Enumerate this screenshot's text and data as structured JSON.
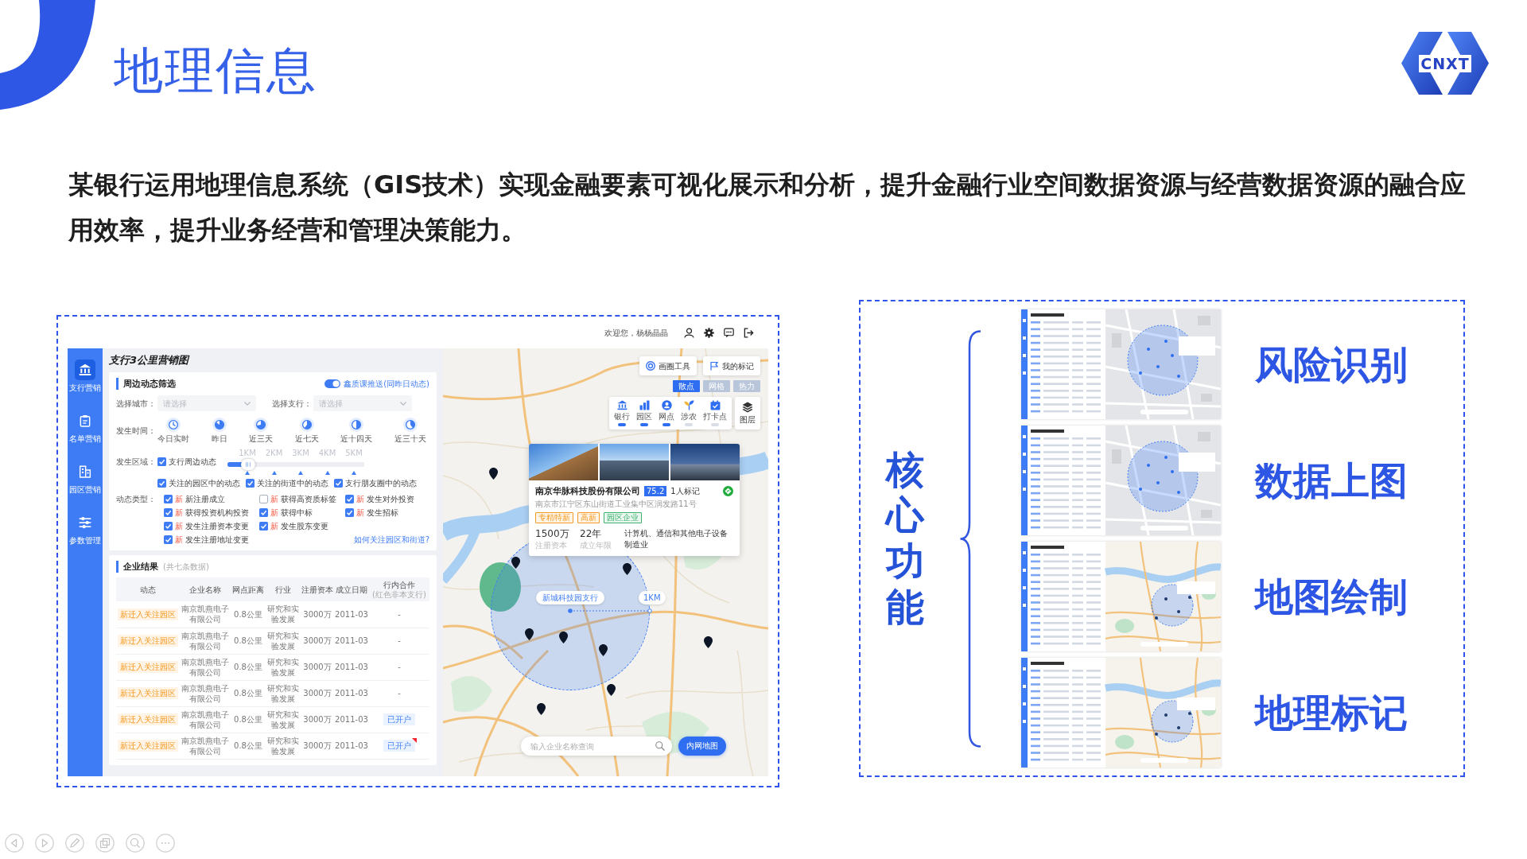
{
  "slide": {
    "title": "地理信息",
    "logo": "CNXT",
    "description": "某银行运用地理信息系统（GIS技术）实现金融要素可视化展示和分析，提升金融行业空间数据资源与经营数据资源的融合应用效率，提升业务经营和管理决策能力。"
  },
  "app": {
    "welcome": "欢迎您，杨杨晶晶",
    "sidebar": [
      {
        "label": "支行营销",
        "selected": true
      },
      {
        "label": "名单营销",
        "selected": false
      },
      {
        "label": "园区营销",
        "selected": false
      },
      {
        "label": "参数管理",
        "selected": false
      }
    ],
    "page_title": "支行3公里营销图",
    "filter": {
      "title": "周边动态筛选",
      "push": {
        "label": "鑫质课推送(同昨日动态)",
        "on": true
      },
      "selects": [
        {
          "label": "选择城市：",
          "placeholder": "请选择"
        },
        {
          "label": "选择支行：",
          "placeholder": "请选择"
        }
      ],
      "time_label": "发生时间：",
      "time_options": [
        "今日实时",
        "昨日",
        "近三天",
        "近七天",
        "近十四天",
        "近三十天"
      ],
      "region_label": "发生区域：",
      "nearby": {
        "label": "支行周边动态",
        "checked": true
      },
      "distance": {
        "marks": [
          "1KM",
          "2KM",
          "3KM",
          "4KM",
          "5KM"
        ],
        "level": 0.15
      },
      "scopes": [
        {
          "label": "关注的园区中的动态",
          "checked": true
        },
        {
          "label": "关注的街道中的动态",
          "checked": true
        },
        {
          "label": "支行朋友圈中的动态",
          "checked": true
        }
      ],
      "type_label": "动态类型：",
      "types": [
        {
          "tag": "新",
          "label": "新注册成立",
          "checked": true
        },
        {
          "tag": "新",
          "label": "获得高资质标签",
          "checked": false
        },
        {
          "tag": "新",
          "label": "发生对外投资",
          "checked": true
        },
        {
          "tag": "新",
          "label": "获得投资机构投资",
          "checked": true
        },
        {
          "tag": "新",
          "label": "获得中标",
          "checked": true
        },
        {
          "tag": "新",
          "label": "发生招标",
          "checked": true
        },
        {
          "tag": "新",
          "label": "发生注册资本变更",
          "checked": true
        },
        {
          "tag": "新",
          "label": "发生股东变更",
          "checked": true
        },
        {
          "tag": "新",
          "label": "发生注册地址变更",
          "checked": true
        }
      ],
      "help_link": "如何关注园区和街道?"
    },
    "results": {
      "title": "企业结果",
      "count": "(共七条数据)",
      "columns": [
        {
          "label": "动态"
        },
        {
          "label": "企业名称"
        },
        {
          "label": "网点距离"
        },
        {
          "label": "行业"
        },
        {
          "label": "注册资本"
        },
        {
          "label": "成立日期"
        },
        {
          "label": "行内合作",
          "note": "(红色非本支行)"
        }
      ],
      "rows": [
        {
          "status": "新迁入关注园区",
          "name": "南京凯燕电子有限公司",
          "distance": "0.8公里",
          "industry": "研究和实验发展",
          "capital": "3000万",
          "founded": "2011-03",
          "cooperation": {
            "kind": "text",
            "text": "-"
          }
        },
        {
          "status": "新迁入关注园区",
          "name": "南京凯燕电子有限公司",
          "distance": "0.8公里",
          "industry": "研究和实验发展",
          "capital": "3000万",
          "founded": "2011-03",
          "cooperation": {
            "kind": "text",
            "text": "-"
          }
        },
        {
          "status": "新迁入关注园区",
          "name": "南京凯燕电子有限公司",
          "distance": "0.8公里",
          "industry": "研究和实验发展",
          "capital": "3000万",
          "founded": "2011-03",
          "cooperation": {
            "kind": "text",
            "text": "-"
          }
        },
        {
          "status": "新迁入关注园区",
          "name": "南京凯燕电子有限公司",
          "distance": "0.8公里",
          "industry": "研究和实验发展",
          "capital": "3000万",
          "founded": "2011-03",
          "cooperation": {
            "kind": "text",
            "text": "-"
          }
        },
        {
          "status": "新迁入关注园区",
          "name": "南京凯燕电子有限公司",
          "distance": "0.8公里",
          "industry": "研究和实验发展",
          "capital": "3000万",
          "founded": "2011-03",
          "cooperation": {
            "kind": "tag",
            "text": "已开户",
            "flagged": false
          }
        },
        {
          "status": "新迁入关注园区",
          "name": "南京凯燕电子有限公司",
          "distance": "0.8公里",
          "industry": "研究和实验发展",
          "capital": "3000万",
          "founded": "2011-03",
          "cooperation": {
            "kind": "tag",
            "text": "已开户",
            "flagged": true
          }
        }
      ]
    },
    "map": {
      "tools": [
        {
          "label": "画圈工具"
        },
        {
          "label": "我的标记"
        }
      ],
      "modes": [
        {
          "label": "散点",
          "selected": true
        },
        {
          "label": "网格",
          "selected": false
        },
        {
          "label": "热力",
          "selected": false
        }
      ],
      "layers": [
        {
          "label": "银行",
          "on": true
        },
        {
          "label": "园区",
          "on": true
        },
        {
          "label": "网点",
          "on": true
        },
        {
          "label": "涉农",
          "on": false
        },
        {
          "label": "打卡点",
          "on": false
        }
      ],
      "layer_button": "图层",
      "popup": {
        "name": "南京华脉科技股份有限公司",
        "score": "75.2",
        "marks": "1人标记",
        "address": "南京市江宁区东山街道工业集中区润发路11号",
        "tags": [
          {
            "label": "专精特新",
            "color": "#f59a23"
          },
          {
            "label": "高新",
            "color": "#f59a23"
          },
          {
            "label": "园区企业",
            "color": "#3bb36b"
          }
        ],
        "stats": [
          {
            "value": "1500万",
            "caption": "注册资本"
          },
          {
            "value": "22年",
            "caption": "成立年限"
          }
        ],
        "industry": "计算机、通信和其他电子设备制造业"
      },
      "branch": "新城科技园支行",
      "radius": "1KM",
      "search_placeholder": "输入企业名称查询",
      "intranet_button": "内网地图"
    }
  },
  "core": {
    "title": "核心功能",
    "items": [
      {
        "label": "风险识别",
        "kind": "street"
      },
      {
        "label": "数据上图",
        "kind": "street"
      },
      {
        "label": "地图绘制",
        "kind": "road"
      },
      {
        "label": "地理标记",
        "kind": "road"
      }
    ]
  }
}
